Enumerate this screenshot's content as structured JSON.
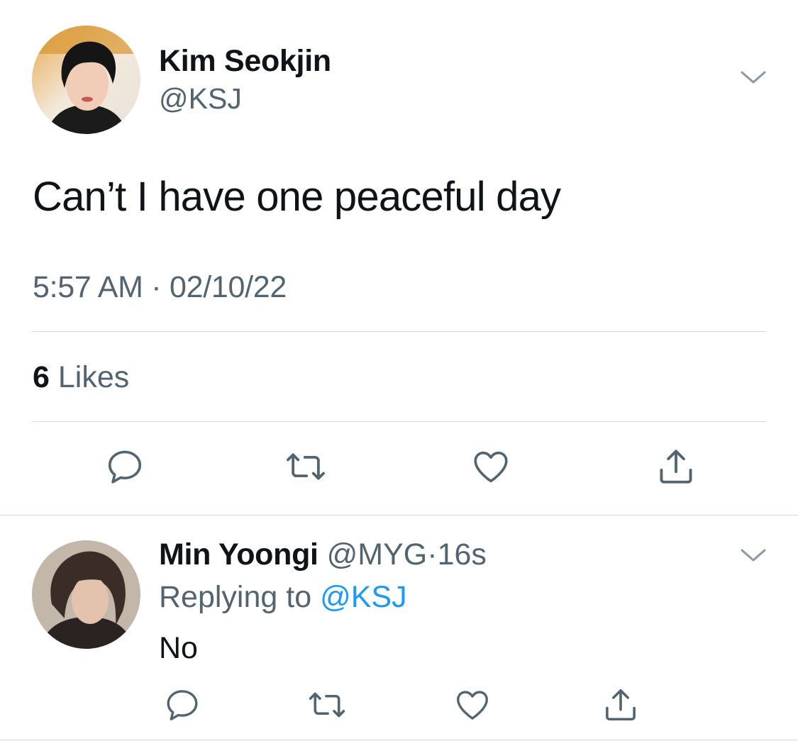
{
  "main_tweet": {
    "author_name": "Kim Seokjin",
    "author_handle": "@KSJ",
    "text": "Can’t I have one peaceful day",
    "timestamp": "5:57 AM · 02/10/22",
    "likes_count": "6",
    "likes_label": "Likes",
    "actions": [
      "reply-icon",
      "retweet-icon",
      "like-icon",
      "share-icon"
    ]
  },
  "reply_tweet": {
    "author_name": "Min Yoongi",
    "author_handle": "@MYG",
    "separator": "·",
    "time": "16s",
    "replying_prefix": "Replying to",
    "replying_to": "@KSJ",
    "text": "No",
    "actions": [
      "reply-icon",
      "retweet-icon",
      "like-icon",
      "share-icon"
    ]
  },
  "colors": {
    "text": "#0f1419",
    "secondary": "#536471",
    "link": "#1d9bf0",
    "divider": "#d6d9db"
  }
}
